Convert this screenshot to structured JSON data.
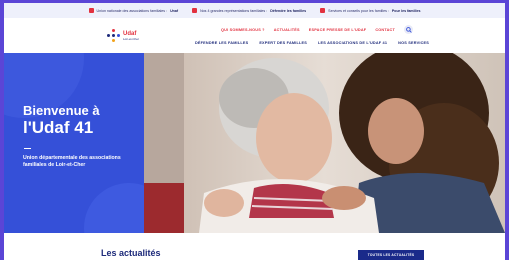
{
  "topbar": {
    "items": [
      {
        "icon": "heart-icon",
        "text": "Union nationale des associations familiales :",
        "strong": "Unaf"
      },
      {
        "icon": "home-icon",
        "text": "Nos 4 grandes représentations familiales :",
        "strong": "Défendre les familles"
      },
      {
        "icon": "people-icon",
        "text": "Services et conseils pour les familles :",
        "strong": "Pour les familles"
      }
    ]
  },
  "logo": {
    "name": "Udaf",
    "tagline": "Loir-et-Cher"
  },
  "topnav": {
    "items": [
      "QUI SOMMES-NOUS ?",
      "ACTUALITÉS",
      "ESPACE PRESSE DE L'UDAF",
      "CONTACT"
    ]
  },
  "mainnav": {
    "items": [
      "DÉFENDRE LES FAMILLES",
      "EXPERT DES FAMILLES",
      "LES ASSOCIATIONS DE L'UDAF 41",
      "NOS SERVICES"
    ]
  },
  "hero": {
    "title_line1": "Bienvenue à",
    "title_line2": "l'Udaf 41",
    "subtitle": "Union départementale des associations familiales de Loir-et-Cher"
  },
  "news": {
    "title": "Les actualités",
    "button": "TOUTES LES ACTUALITÉS"
  },
  "colors": {
    "primary": "#3550d8",
    "accent": "#e2313f",
    "navy": "#1d2a7a",
    "frame": "#5b45d6"
  }
}
